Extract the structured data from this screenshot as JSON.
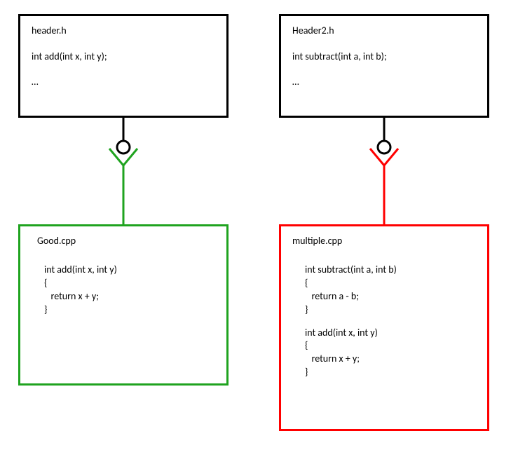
{
  "left": {
    "header": {
      "title": "header.h",
      "decl": "int add(int x, int y);",
      "more": "…"
    },
    "cpp": {
      "title": "Good.cpp",
      "func": "int add(int x, int y)\n{\n   return x + y;\n}"
    }
  },
  "right": {
    "header": {
      "title": "Header2.h",
      "decl": "int subtract(int a, int b);",
      "more": "…"
    },
    "cpp": {
      "title": "multiple.cpp",
      "block1": "int subtract(int a, int b)\n{\n   return a - b;\n}",
      "block2": "int add(int x, int y)\n{\n   return x + y;\n}"
    }
  },
  "colors": {
    "good": "#1fa31f",
    "bad": "#ff0000",
    "neutral": "#000000"
  }
}
